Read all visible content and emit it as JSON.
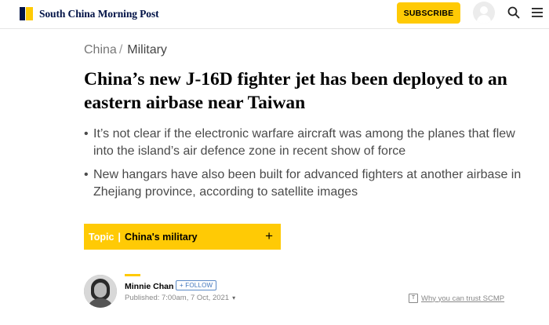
{
  "header": {
    "logo_text": "South China Morning Post",
    "subscribe_label": "SUBSCRIBE",
    "icons": [
      "avatar-icon",
      "search-icon",
      "menu-icon"
    ]
  },
  "breadcrumb": {
    "items": [
      "China",
      "Military"
    ],
    "separator": "/"
  },
  "article": {
    "headline": "China’s new J-16D fighter jet has been deployed to an eastern airbase near Taiwan",
    "bullets": [
      "It’s not clear if the electronic warfare aircraft was among the planes that flew into the island’s air defence zone in recent show of force",
      "New hangars have also been built for advanced fighters at another airbase in Zhejiang province, according to satellite images"
    ]
  },
  "topic": {
    "label": "Topic",
    "divider": "|",
    "name": "China's military",
    "expand_symbol": "+"
  },
  "author": {
    "name": "Minnie Chan",
    "follow_label": "+ FOLLOW",
    "published": "Published: 7:00am, 7 Oct, 2021",
    "chevron": "▾"
  },
  "trust": {
    "label": "Why you can trust SCMP",
    "icon_glyph": "T"
  },
  "colors": {
    "brand_navy": "#001246",
    "accent_yellow": "#ffca05",
    "follow_blue": "#3f74bb"
  }
}
